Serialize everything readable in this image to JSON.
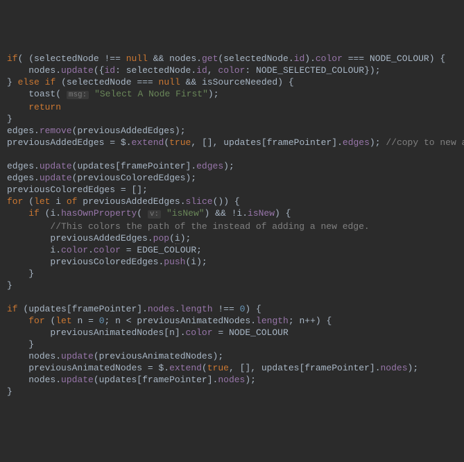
{
  "tokens": {
    "if": "if",
    "else": "else",
    "for": "for",
    "let": "let",
    "of": "of",
    "return": "return",
    "true": "true",
    "null": "null",
    "selectedNode": "selectedNode",
    "nodes": "nodes",
    "edges": "edges",
    "updates": "updates",
    "framePointer": "framePointer",
    "previousAddedEdges": "previousAddedEdges",
    "previousColoredEdges": "previousColoredEdges",
    "previousAnimatedNodes": "previousAnimatedNodes",
    "isSourceNeeded": "isSourceNeeded",
    "NODE_COLOUR": "NODE_COLOUR",
    "NODE_SELECTED_COLOUR": "NODE_SELECTED_COLOUR",
    "EDGE_COLOUR": "EDGE_COLOUR",
    "toast": "toast",
    "i": "i",
    "n": "n",
    "dollar": "$"
  },
  "methods": {
    "get": "get",
    "update": "update",
    "remove": "remove",
    "extend": "extend",
    "slice": "slice",
    "hasOwnProperty": "hasOwnProperty",
    "pop": "pop",
    "push": "push"
  },
  "props": {
    "id": "id",
    "color": "color",
    "edges": "edges",
    "nodes": "nodes",
    "length": "length",
    "isNew": "isNew"
  },
  "strings": {
    "selectNode": "\"Select A Node First\"",
    "isNewStr": "\"isNew\""
  },
  "numbers": {
    "zero": "0"
  },
  "hints": {
    "msg": "msg:",
    "v": "v:"
  },
  "comments": {
    "copyNewArray": "//copy to new array",
    "colorsPath": "//This colors the path of the instead of adding a new edge."
  },
  "symbols": {
    "lpar": "(",
    "rpar": ")",
    "lbrace": "{",
    "rbrace": "}",
    "lbrack": "[",
    "rbrack": "]",
    "semi": ";",
    "comma": ",",
    "dot": ".",
    "bang": "!",
    "teq": "===",
    "tne": "!==",
    "and": "&&",
    "assign": "=",
    "colon": ":",
    "lt": "<",
    "pp": "++"
  }
}
